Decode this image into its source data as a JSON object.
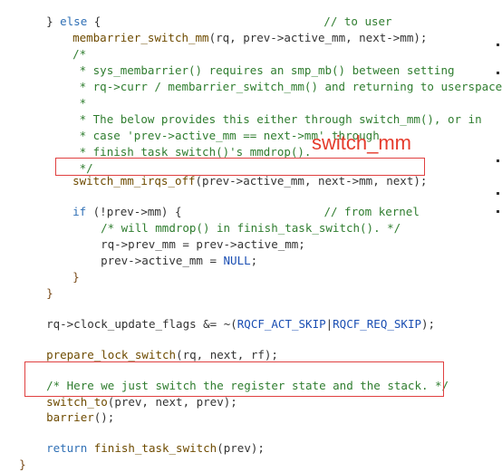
{
  "code": {
    "line1": {
      "brace": "} ",
      "kw": "else",
      "brace2": " {",
      "comment": "// to user"
    },
    "line2": {
      "fn": "membarrier_switch_mm",
      "args": "(rq, prev->active_mm, next->mm);"
    },
    "line3": {
      "comment": "/*"
    },
    "line4": {
      "comment": " * sys_membarrier() requires an smp_mb() between setting"
    },
    "line5": {
      "comment": " * rq->curr / membarrier_switch_mm() and returning to userspace"
    },
    "line6": {
      "comment": " *"
    },
    "line7": {
      "comment": " * The below provides this either through switch_mm(), or in"
    },
    "line8": {
      "comment": " * case 'prev->active_mm == next->mm' through"
    },
    "line9": {
      "comment": " * finish_task_switch()'s mmdrop()."
    },
    "line10": {
      "comment": " */"
    },
    "line11": {
      "fn": "switch_mm_irqs_off",
      "args": "(prev->active_mm, next->mm, next);"
    },
    "line12": {
      "kw": "if",
      "cond": " (!prev->mm) {",
      "comment": "// from kernel"
    },
    "line13": {
      "comment": "/* will mmdrop() in finish_task_switch(). */"
    },
    "line14": {
      "text": "rq->prev_mm = prev->active_mm;"
    },
    "line15": {
      "text": "prev->active_mm = ",
      "const": "NULL",
      "end": ";"
    },
    "line16": {
      "text": "}"
    },
    "line17": {
      "text": "}"
    },
    "line18": {
      "text": "rq->clock_update_flags &= ~(",
      "c1": "RQCF_ACT_SKIP",
      "mid": "|",
      "c2": "RQCF_REQ_SKIP",
      "end": ");"
    },
    "line19": {
      "fn": "prepare_lock_switch",
      "args": "(rq, next, rf);"
    },
    "line20": {
      "comment": "/* Here we just switch the register state and the stack. */"
    },
    "line21": {
      "fn": "switch_to",
      "args": "(prev, next, prev);"
    },
    "line22": {
      "fn": "barrier",
      "args": "();"
    },
    "line23": {
      "kw": "return",
      "fn": " finish_task_switch",
      "args": "(prev);"
    },
    "line24": {
      "text": "}"
    }
  },
  "annotation": {
    "label": "switch_mm"
  }
}
